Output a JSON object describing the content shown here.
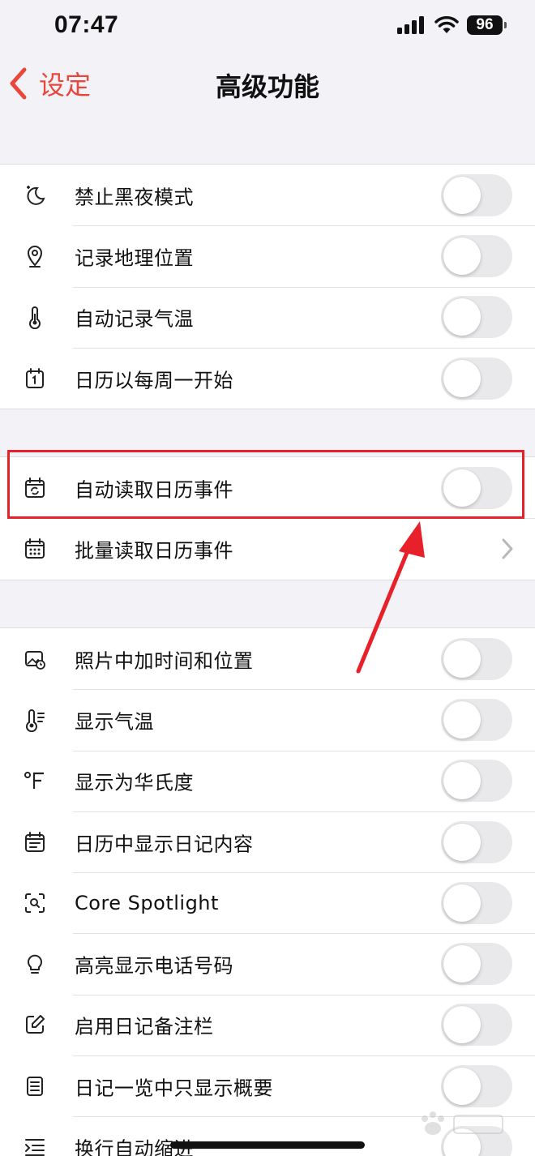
{
  "status_bar": {
    "time": "07:47",
    "battery": "96"
  },
  "nav": {
    "back_label": "设定",
    "title": "高级功能"
  },
  "groups": [
    {
      "rows": [
        {
          "icon": "moon-icon",
          "label": "禁止黑夜模式",
          "control": "toggle",
          "on": false
        },
        {
          "icon": "location-pin-icon",
          "label": "记录地理位置",
          "control": "toggle",
          "on": false
        },
        {
          "icon": "thermometer-icon",
          "label": "自动记录气温",
          "control": "toggle",
          "on": false
        },
        {
          "icon": "calendar-one-icon",
          "label": "日历以每周一开始",
          "control": "toggle",
          "on": false
        }
      ]
    },
    {
      "rows": [
        {
          "icon": "calendar-sync-icon",
          "label": "自动读取日历事件",
          "control": "toggle",
          "on": false
        },
        {
          "icon": "calendar-grid-icon",
          "label": "批量读取日历事件",
          "control": "chevron"
        }
      ]
    },
    {
      "rows": [
        {
          "icon": "photo-icon",
          "label": "照片中加时间和位置",
          "control": "toggle",
          "on": false
        },
        {
          "icon": "thermometer-lines-icon",
          "label": "显示气温",
          "control": "toggle",
          "on": false
        },
        {
          "icon": "fahrenheit-icon",
          "label": "显示为华氏度",
          "control": "toggle",
          "on": false
        },
        {
          "icon": "calendar-list-icon",
          "label": "日历中显示日记内容",
          "control": "toggle",
          "on": false
        },
        {
          "icon": "spotlight-icon",
          "label": "Core Spotlight",
          "control": "toggle",
          "on": false
        },
        {
          "icon": "lightbulb-icon",
          "label": "高亮显示电话号码",
          "control": "toggle",
          "on": false
        },
        {
          "icon": "edit-note-icon",
          "label": "启用日记备注栏",
          "control": "toggle",
          "on": false
        },
        {
          "icon": "document-icon",
          "label": "日记一览中只显示概要",
          "control": "toggle",
          "on": false
        },
        {
          "icon": "indent-icon",
          "label": "换行自动缩进",
          "control": "toggle",
          "on": false
        }
      ]
    }
  ],
  "colors": {
    "accent": "#e8473c",
    "annotation": "#e8202a",
    "toggle_off": "#e9e9eb",
    "background": "#f2f2f7"
  }
}
